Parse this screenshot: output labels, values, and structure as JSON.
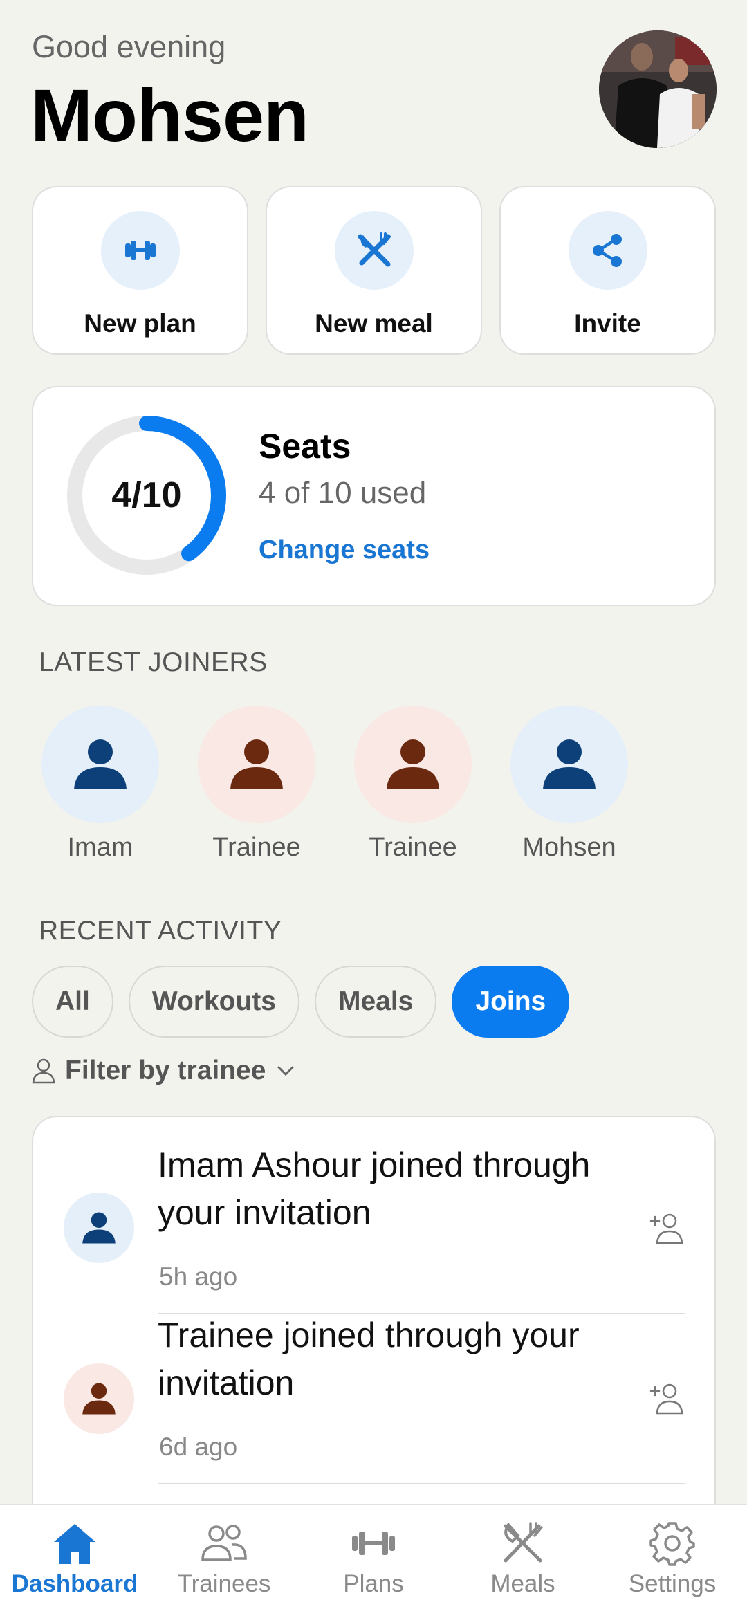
{
  "header": {
    "greeting": "Good evening",
    "name": "Mohsen"
  },
  "quick_actions": [
    {
      "label": "New plan",
      "icon": "dumbbell-icon"
    },
    {
      "label": "New meal",
      "icon": "utensils-icon"
    },
    {
      "label": "Invite",
      "icon": "share-icon"
    }
  ],
  "seats": {
    "ring_label": "4/10",
    "used": 4,
    "total": 10,
    "title": "Seats",
    "subtitle": "4 of 10 used",
    "link": "Change seats"
  },
  "latest_joiners": {
    "title": "LATEST JOINERS",
    "items": [
      {
        "name": "Imam",
        "tone": "blue"
      },
      {
        "name": "Trainee",
        "tone": "brown"
      },
      {
        "name": "Trainee",
        "tone": "brown"
      },
      {
        "name": "Mohsen",
        "tone": "blue"
      }
    ]
  },
  "recent_activity": {
    "title": "RECENT ACTIVITY",
    "chips": [
      "All",
      "Workouts",
      "Meals",
      "Joins"
    ],
    "active_chip": "Joins",
    "filter_label": "Filter by trainee",
    "items": [
      {
        "text": "Imam Ashour joined through your invitation",
        "time": "5h ago",
        "tone": "blue"
      },
      {
        "text": "Trainee joined through your invitation",
        "time": "6d ago",
        "tone": "brown"
      }
    ]
  },
  "nav": {
    "items": [
      {
        "label": "Dashboard",
        "icon": "home-icon"
      },
      {
        "label": "Trainees",
        "icon": "people-icon"
      },
      {
        "label": "Plans",
        "icon": "dumbbell-icon"
      },
      {
        "label": "Meals",
        "icon": "utensils-icon"
      },
      {
        "label": "Settings",
        "icon": "gear-icon"
      }
    ],
    "active": "Dashboard"
  },
  "colors": {
    "accent": "#0a7cf0",
    "link": "#1976d2",
    "avatar_blue_bg": "#e4effa",
    "avatar_blue_fg": "#0d3f78",
    "avatar_brown_bg": "#f9e8e3",
    "avatar_brown_fg": "#6b2a10"
  }
}
